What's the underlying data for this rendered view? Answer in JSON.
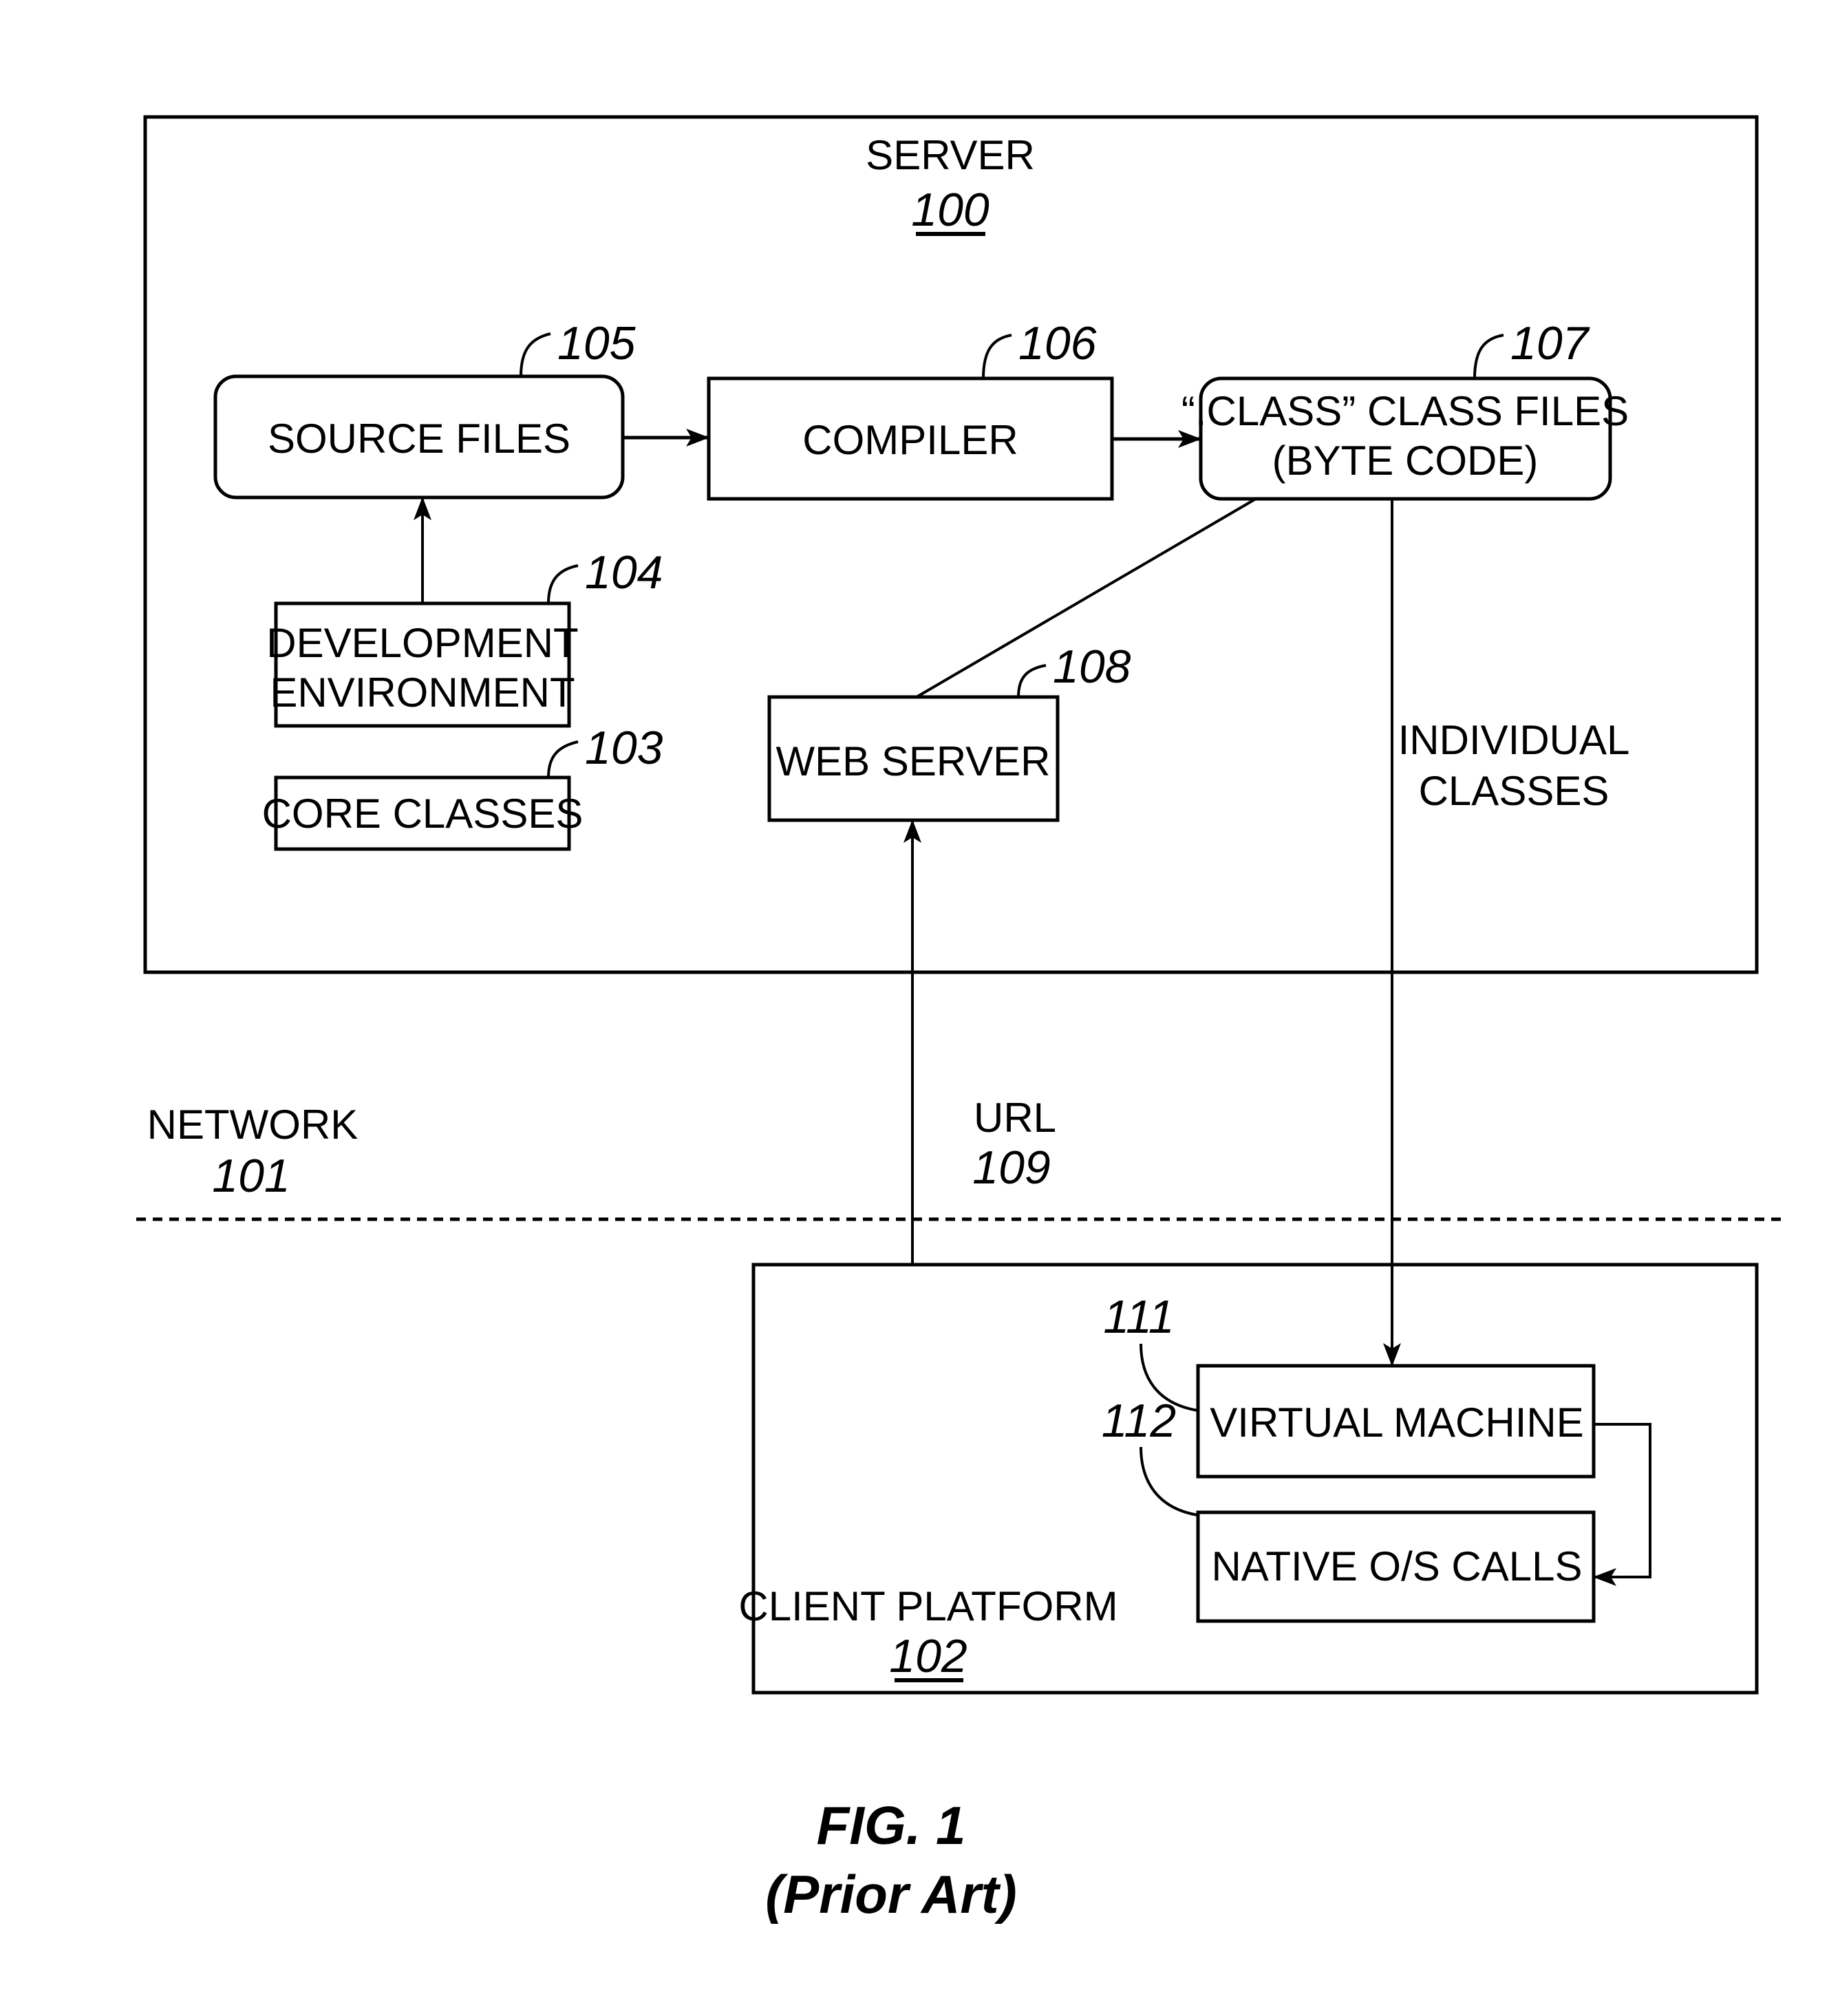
{
  "figure": {
    "caption": "FIG. 1",
    "subcaption": "(Prior Art)"
  },
  "server": {
    "title": "SERVER",
    "ref": "100"
  },
  "network": {
    "title": "NETWORK",
    "ref": "101"
  },
  "client": {
    "title": "CLIENT PLATFORM",
    "ref": "102"
  },
  "blocks": {
    "source_files": {
      "label": "SOURCE FILES",
      "ref": "105"
    },
    "compiler": {
      "label": "COMPILER",
      "ref": "106"
    },
    "class_files": {
      "line1": "“.CLASS” CLASS FILES",
      "line2": "(BYTE CODE)",
      "ref": "107"
    },
    "dev_env": {
      "line1": "DEVELOPMENT",
      "line2": "ENVIRONMENT",
      "ref": "104"
    },
    "core_classes": {
      "label": "CORE CLASSES",
      "ref": "103"
    },
    "web_server": {
      "label": "WEB SERVER",
      "ref": "108"
    },
    "virtual_machine": {
      "label": "VIRTUAL MACHINE",
      "ref": "111"
    },
    "native_calls": {
      "label": "NATIVE O/S CALLS",
      "ref": "112"
    }
  },
  "connections": {
    "individual_classes": {
      "line1": "INDIVIDUAL",
      "line2": "CLASSES"
    },
    "url": {
      "label": "URL",
      "ref": "109"
    }
  }
}
